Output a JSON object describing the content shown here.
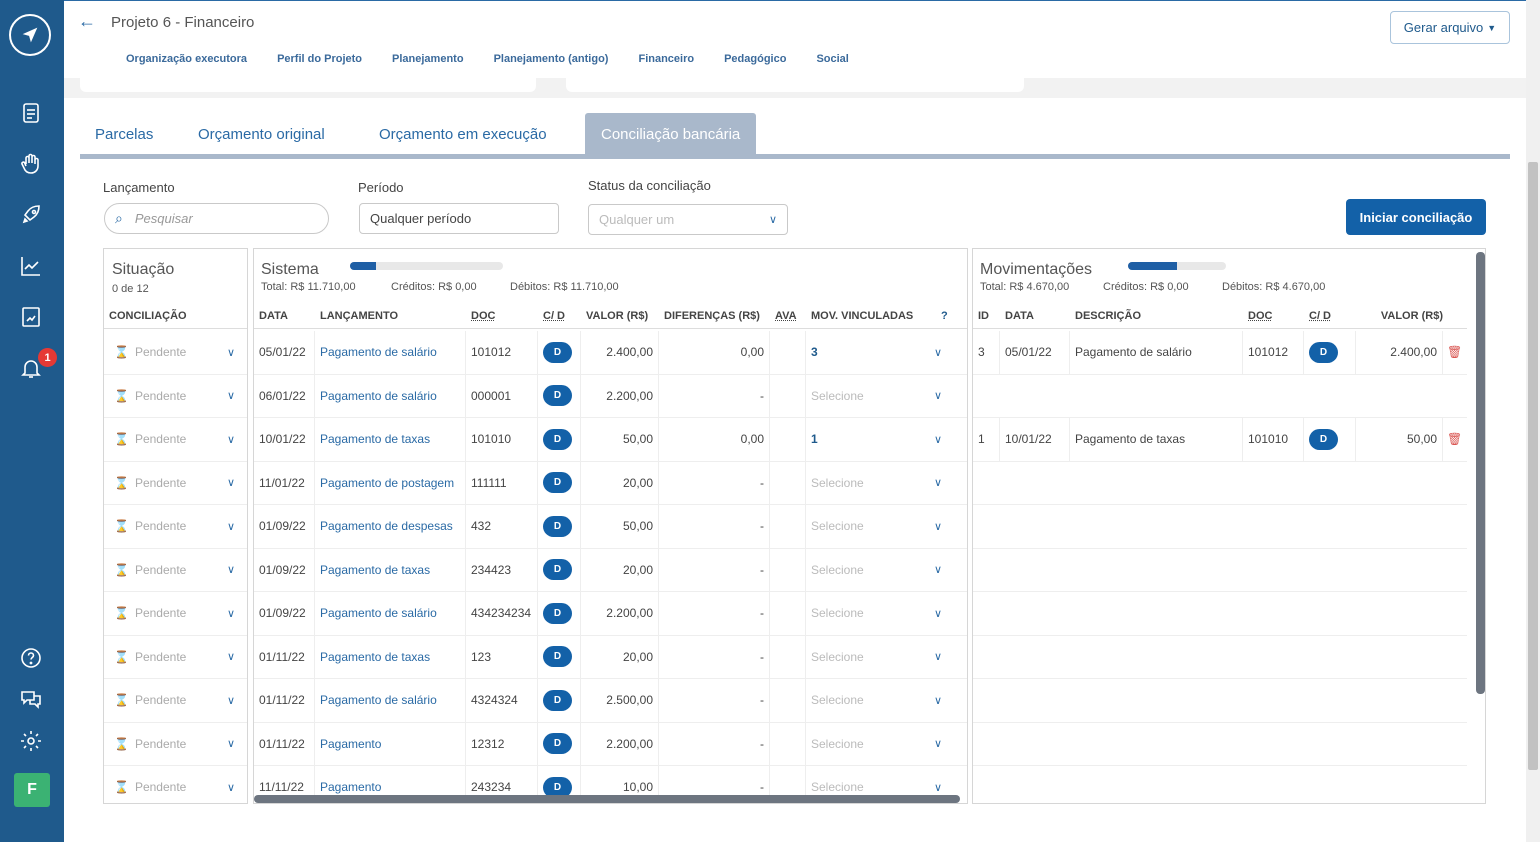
{
  "app": {
    "title": "Projeto 6 - Financeiro",
    "gerar": "Gerar arquivo"
  },
  "nav": [
    "Organização executora",
    "Perfil do Projeto",
    "Planejamento",
    "Planejamento (antigo)",
    "Financeiro",
    "Pedagógico",
    "Social"
  ],
  "tabs": [
    "Parcelas",
    "Orçamento original",
    "Orçamento em execução",
    "Conciliação bancária"
  ],
  "sidebar": {
    "notif_count": "1",
    "avatar": "F"
  },
  "filters": {
    "lanc_label": "Lançamento",
    "lanc_placeholder": "Pesquisar",
    "periodo_label": "Período",
    "periodo_value": "Qualquer período",
    "status_label": "Status da conciliação",
    "status_value": "Qualquer um",
    "iniciar": "Iniciar conciliação"
  },
  "situacao": {
    "title": "Situação",
    "sub": "0 de 12",
    "header": "CONCILIAÇÃO",
    "status": "Pendente"
  },
  "sistema": {
    "title": "Sistema",
    "total": "Total: R$ 11.710,00",
    "creditos": "Créditos: R$ 0,00",
    "debitos": "Débitos: R$ 11.710,00",
    "progress": 0.17,
    "headers": [
      "DATA",
      "LANÇAMENTO",
      "DOC",
      "C/ D",
      "VALOR (R$)",
      "DIFERENÇAS (R$)",
      "AVA",
      "MOV. VINCULADAS"
    ],
    "rows": [
      [
        "05/01/22",
        "Pagamento de salário",
        "101012",
        "D",
        "2.400,00",
        "0,00",
        "3"
      ],
      [
        "06/01/22",
        "Pagamento de salário",
        "000001",
        "D",
        "2.200,00",
        "-",
        "Selecione"
      ],
      [
        "10/01/22",
        "Pagamento de taxas",
        "101010",
        "D",
        "50,00",
        "0,00",
        "1"
      ],
      [
        "11/01/22",
        "Pagamento de postagem",
        "111111",
        "D",
        "20,00",
        "-",
        "Selecione"
      ],
      [
        "01/09/22",
        "Pagamento de despesas",
        "432",
        "D",
        "50,00",
        "-",
        "Selecione"
      ],
      [
        "01/09/22",
        "Pagamento de taxas",
        "234423",
        "D",
        "20,00",
        "-",
        "Selecione"
      ],
      [
        "01/09/22",
        "Pagamento de salário",
        "434234234",
        "D",
        "2.200,00",
        "-",
        "Selecione"
      ],
      [
        "01/11/22",
        "Pagamento de taxas",
        "123",
        "D",
        "20,00",
        "-",
        "Selecione"
      ],
      [
        "01/11/22",
        "Pagamento de salário",
        "4324324",
        "D",
        "2.500,00",
        "-",
        "Selecione"
      ],
      [
        "01/11/22",
        "Pagamento",
        "12312",
        "D",
        "2.200,00",
        "-",
        "Selecione"
      ],
      [
        "11/11/22",
        "Pagamento",
        "243234",
        "D",
        "10,00",
        "-",
        "Selecione"
      ]
    ]
  },
  "mov": {
    "title": "Movimentações",
    "total": "Total: R$ 4.670,00",
    "creditos": "Créditos: R$ 0,00",
    "debitos": "Débitos: R$ 4.670,00",
    "progress": 0.5,
    "headers": [
      "ID",
      "DATA",
      "DESCRIÇÃO",
      "DOC",
      "C/ D",
      "VALOR (R$)"
    ],
    "rows": [
      [
        "3",
        "05/01/22",
        "Pagamento de salário",
        "101012",
        "D",
        "2.400,00"
      ],
      null,
      [
        "1",
        "10/01/22",
        "Pagamento de taxas",
        "101010",
        "D",
        "50,00"
      ]
    ]
  }
}
